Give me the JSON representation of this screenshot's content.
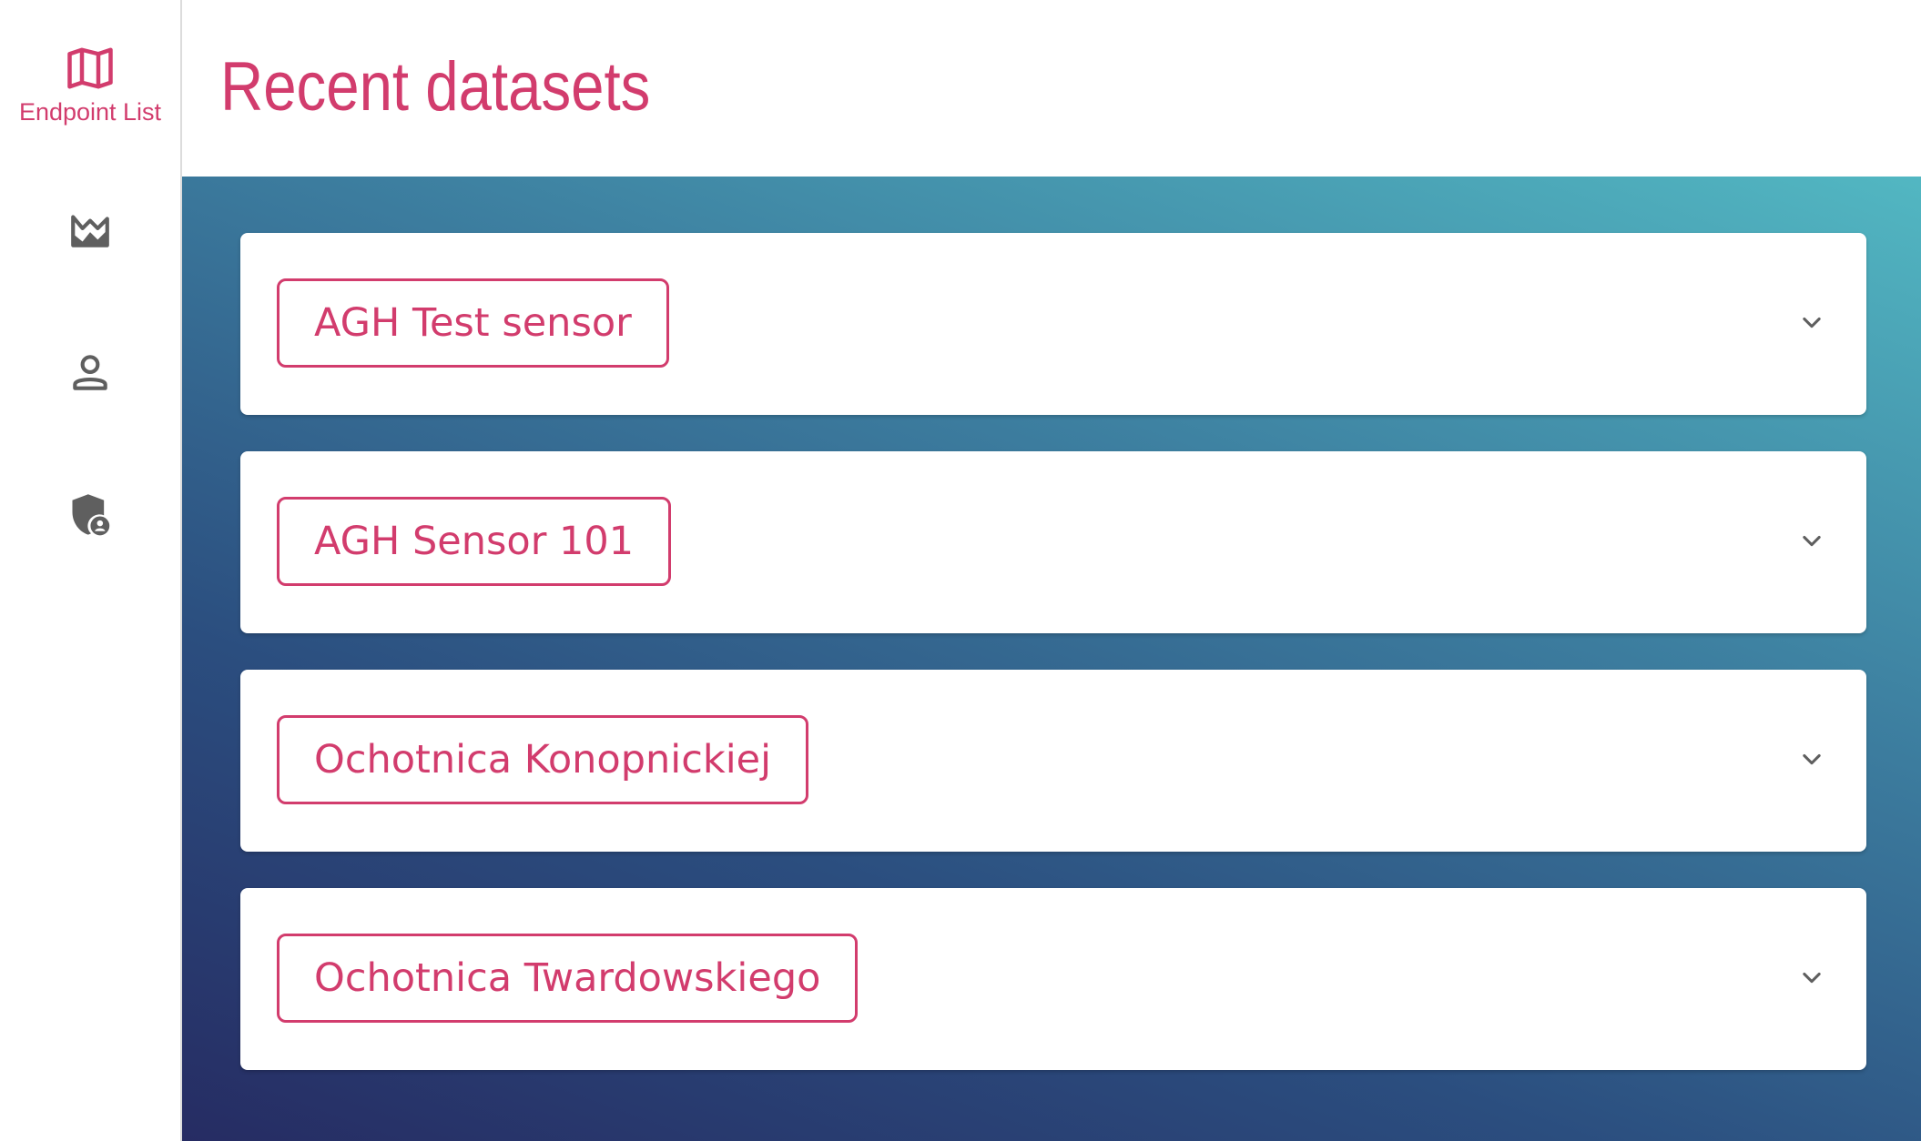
{
  "sidebar": {
    "items": [
      {
        "id": "endpoint-list",
        "icon": "map-icon",
        "label": "Endpoint List",
        "active": true
      },
      {
        "id": "charts",
        "icon": "area-chart-icon",
        "label": ""
      },
      {
        "id": "profile",
        "icon": "person-icon",
        "label": ""
      },
      {
        "id": "admin",
        "icon": "admin-shield-icon",
        "label": ""
      }
    ]
  },
  "header": {
    "title": "Recent datasets"
  },
  "datasets": [
    {
      "name": "AGH Test sensor"
    },
    {
      "name": "AGH Sensor 101"
    },
    {
      "name": "Ochotnica Konopnickiej"
    },
    {
      "name": "Ochotnica Twardowskiego"
    }
  ],
  "colors": {
    "accent": "#d23c6d",
    "icon_gray": "#5f5f5f",
    "gradient_start": "#262c63",
    "gradient_end": "#52b7c2"
  }
}
